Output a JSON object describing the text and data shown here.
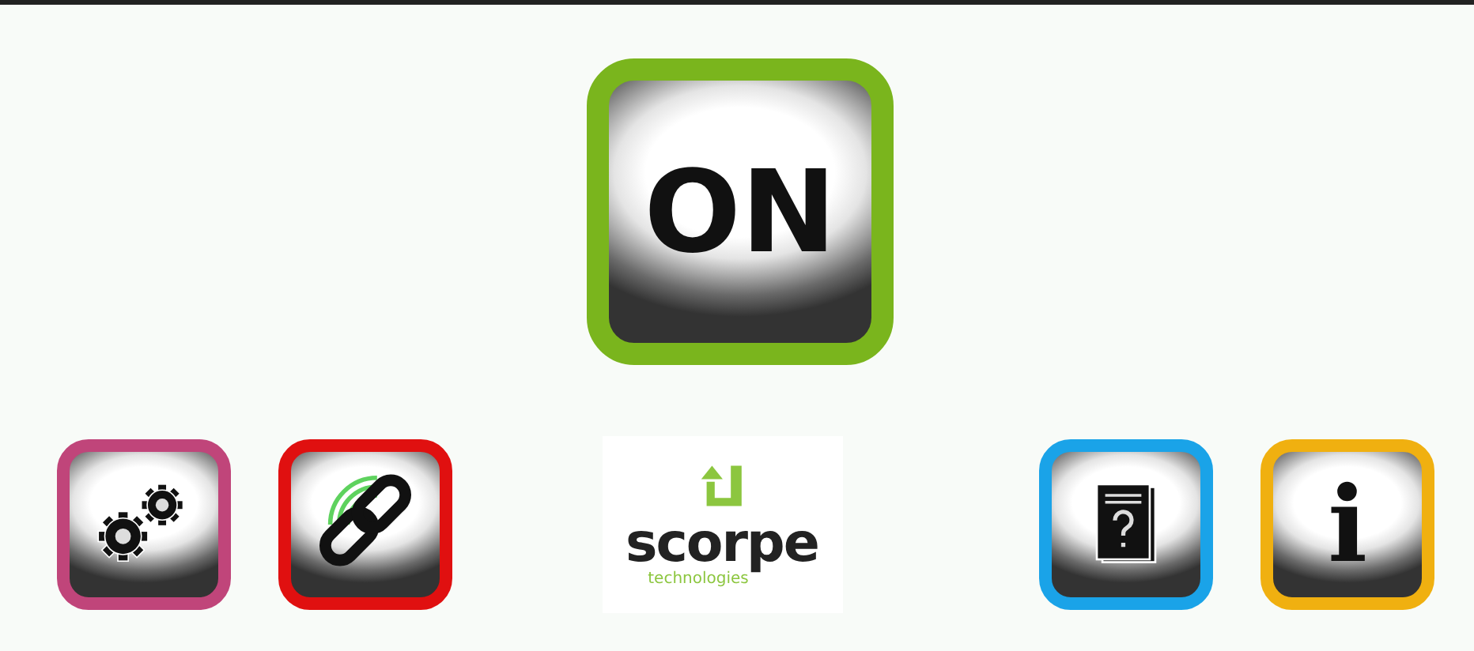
{
  "power_button": {
    "label": "ON",
    "color": "#7ab51d"
  },
  "left_buttons": [
    {
      "kind": "settings",
      "color": "#c0457a"
    },
    {
      "kind": "link",
      "color": "#e01010"
    }
  ],
  "logo": {
    "name": "scorpe",
    "tagline": "technologies"
  },
  "right_buttons": [
    {
      "kind": "help",
      "color": "#1aa3e8"
    },
    {
      "kind": "info",
      "label": "i",
      "color": "#f0b010"
    }
  ]
}
